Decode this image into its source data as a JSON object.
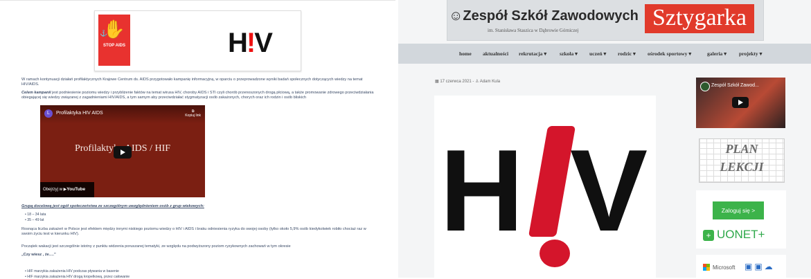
{
  "left": {
    "stop_aids": "STOP AIDS",
    "hiv_logo": {
      "h": "H",
      "ex": "!",
      "v": "V"
    },
    "para1": "W ramach kontynuacji działań profilaktycznych Krajowe Centrum ds. AIDS przygotowało kampanię informacyjną, w oparciu o przeprowadzone wyniki badań społecznych dotyczących wiedzy na temat HIV/AIDS.",
    "para2_bold": "Celem kampanii",
    "para2": " jest podniesienie poziomu wiedzy i przybliżenie faktów na temat wirusa HIV, choroby AIDS i STI czyli chorób przenoszonych drogą płciową, a także promowanie zdrowego przeciwdziałania obiegającej się wiedzy związanej z zagadnieniami HIV/AIDS, a tym samym aby przeciwdziałać stygmatyzacji osób zakażonych, chorych oraz ich rodzin i osób bliskich",
    "video": {
      "channel_initial": "L",
      "title": "Profilaktyka HIV AIDS",
      "copy_link": "Kopiuj link",
      "overlay": "Profilaktyka AIDS / HIF",
      "watch_on": "Obejrzyj w",
      "youtube": "YouTube"
    },
    "target_group": "Grupą docelową jest ogół społeczeństwa ze szczególnym uwzględnieniem osób z grup wiekowych:",
    "ages": [
      "18 – 34 lata",
      "35 – 49 lat"
    ],
    "para3": "Rosnąca liczba zakażeń w Polsce jest efektem między innymi niskiego poziomu wiedzy o HIV i AIDS i braku odniesienia ryzyka do swojej osoby (tylko około 5,9% osób kiedykolwiek robiło chociaż raz w swoim życiu test w kierunku HIV).",
    "para4": "Początek wakacji jest szczególnie istotny z punktu widzenia poruszanej tematyki, ze względu na podwyższony poziom ryzykownych zachowań w tym okresie",
    "czy_wiesz": "„Czy wiesz , że….”",
    "facts": [
      "HIF marzykia zakażenia HIV podczas pływania w basenie",
      "HIF marzykia zakażenia HIV drogą kropelkową, przez całowanie"
    ]
  },
  "right": {
    "school_name": "Zespół Szkół Zawodowych",
    "school_sub": "im. Stanisława Staszica w Dąbrowie Górniczej",
    "brand": "Sztygarka",
    "nav": [
      "home",
      "aktualności",
      "rekrutacja ▾",
      "szkoła ▾",
      "uczeń ▾",
      "rodzic ▾",
      "ośrodek sportowy ▾",
      "galeria ▾",
      "projekty ▾"
    ],
    "post_date": "17 czerwca 2021",
    "post_author": "Adam Kula",
    "yt_title": "Zespół Szkół Zawod...",
    "plan1": "PLAN",
    "plan2": "LEKCJI",
    "login": "Zaloguj się >",
    "uonet": "UONET+",
    "microsoft": "Microsoft"
  }
}
